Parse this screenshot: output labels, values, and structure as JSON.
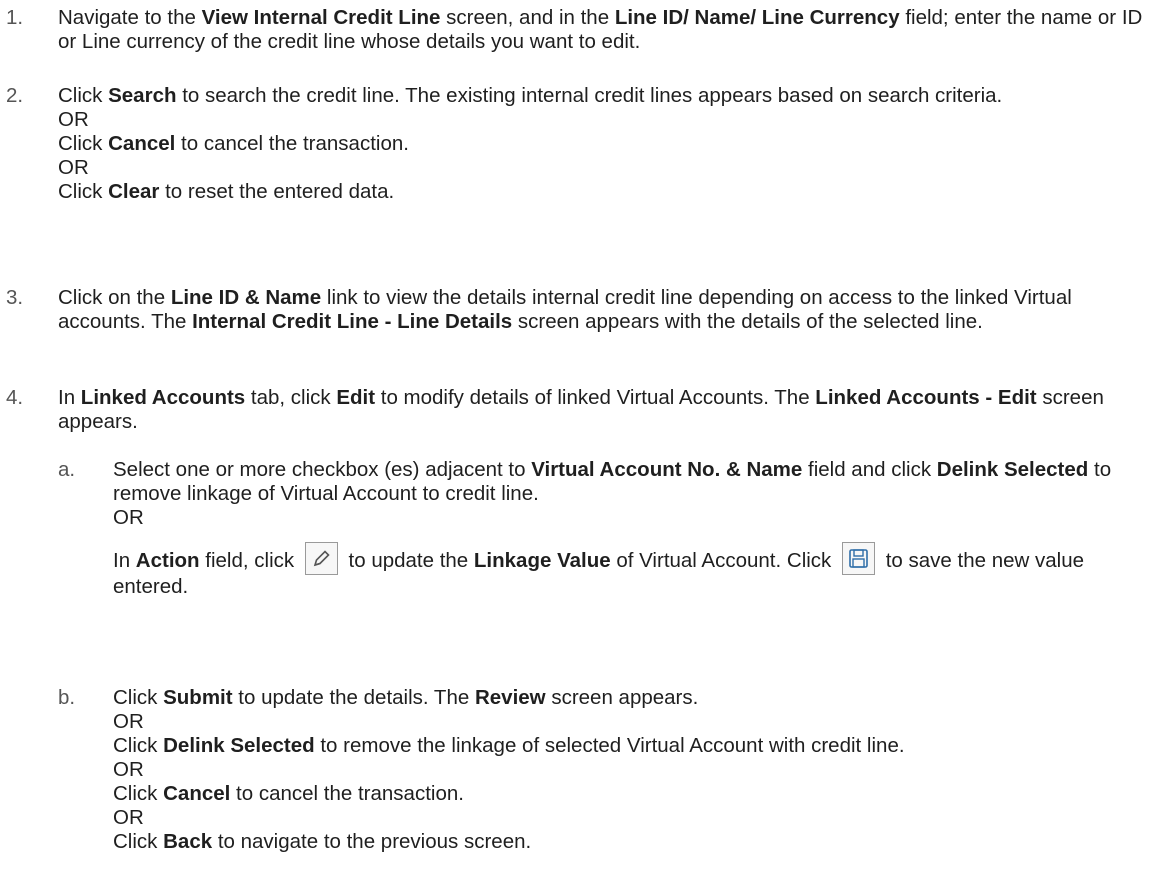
{
  "steps": [
    {
      "num": "1.",
      "p": [
        "Navigate to the ",
        "View Internal Credit Line",
        " screen, and in the ",
        "Line ID/ Name/ Line Currency",
        " field; enter the name or ID or Line currency of the credit line whose details you want to edit."
      ]
    },
    {
      "num": "2.",
      "a": [
        "Click ",
        "Search",
        " to search the credit line. The existing internal credit lines appears based on search criteria."
      ],
      "or1": "OR",
      "b": [
        "Click ",
        "Cancel",
        " to cancel the transaction."
      ],
      "or2": "OR",
      "c": [
        "Click ",
        "Clear",
        " to reset the entered data."
      ]
    },
    {
      "num": "3.",
      "p": [
        "Click on the ",
        "Line ID & Name",
        " link to view the details internal credit line depending on access to the linked Virtual accounts. The ",
        "Internal Credit Line - Line Details",
        " screen appears with the details of the selected line."
      ]
    },
    {
      "num": "4.",
      "p": [
        "In ",
        "Linked Accounts",
        " tab, click ",
        "Edit",
        " to modify details of linked Virtual Accounts. The ",
        "Linked Accounts - Edit",
        " screen appears."
      ],
      "subs": [
        {
          "num": "a.",
          "p": [
            "Select one or more checkbox (es) adjacent to ",
            "Virtual Account No. & Name",
            " field and click ",
            "Delink Selected",
            " to remove linkage of Virtual Account to credit line."
          ],
          "or": "OR",
          "q": [
            "In ",
            "Action",
            " field, click ",
            " to update the ",
            "Linkage Value",
            " of Virtual Account. Click ",
            " to save the new value entered."
          ]
        },
        {
          "num": "b.",
          "l1": [
            "Click ",
            "Submit",
            " to update the details. The ",
            "Review",
            " screen appears."
          ],
          "or1": "OR",
          "l2": [
            "Click ",
            "Delink Selected",
            " to remove the linkage of selected Virtual Account with credit line."
          ],
          "or2": "OR",
          "l3": [
            "Click ",
            "Cancel",
            " to cancel the transaction."
          ],
          "or3": "OR",
          "l4": [
            "Click ",
            "Back",
            " to navigate to the previous screen."
          ]
        }
      ]
    }
  ],
  "icons": {
    "edit": "pencil-edit-icon",
    "save": "floppy-save-icon"
  }
}
